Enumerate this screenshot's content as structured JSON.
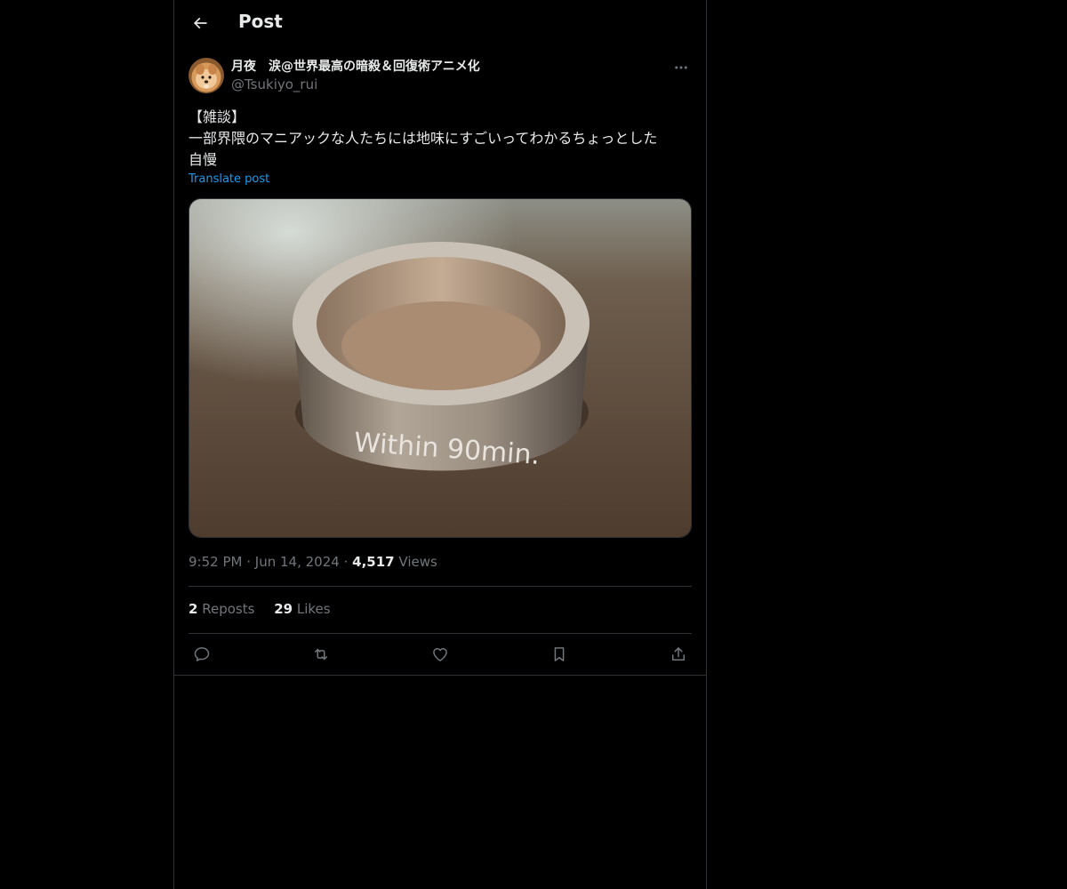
{
  "header": {
    "title": "Post",
    "back_icon": "arrow-left-icon"
  },
  "post": {
    "author": {
      "display_name": "月夜　涙@世界最高の暗殺＆回復術アニメ化",
      "handle": "@Tsukiyo_rui"
    },
    "text_lines": [
      "【雑談】",
      "一部界隈のマニアックな人たちには地味にすごいってわかるちょっとした",
      "自慢"
    ],
    "translate_label": "Translate post",
    "media": {
      "engraving": "Within 90min."
    },
    "time": "9:52 PM",
    "separator": "·",
    "date": "Jun 14, 2024",
    "views_count": "4,517",
    "views_label": "Views",
    "reposts_count": "2",
    "reposts_label": "Reposts",
    "likes_count": "29",
    "likes_label": "Likes",
    "actions": [
      "reply-icon",
      "repost-icon",
      "like-icon",
      "bookmark-icon",
      "share-icon"
    ]
  },
  "colors": {
    "background": "#000000",
    "text": "#e7e9ea",
    "muted": "#71767b",
    "link": "#1d9bf0",
    "border": "#2f3336"
  }
}
